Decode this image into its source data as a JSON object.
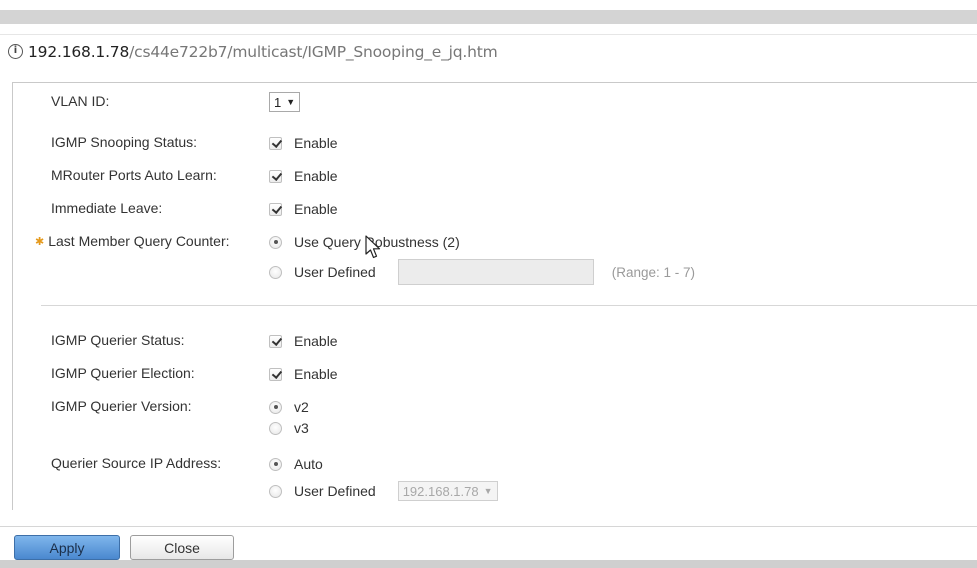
{
  "browser": {
    "url_host": "192.168.1.78",
    "url_path": "/cs44e722b7/multicast/IGMP_Snooping_e_jq.htm"
  },
  "form": {
    "vlan_id": {
      "label": "VLAN ID:",
      "value": "1"
    },
    "igmp_snooping_status": {
      "label": "IGMP Snooping Status:",
      "option": "Enable",
      "checked": true
    },
    "mrouter_auto_learn": {
      "label": "MRouter Ports Auto Learn:",
      "option": "Enable",
      "checked": true
    },
    "immediate_leave": {
      "label": "Immediate Leave:",
      "option": "Enable",
      "checked": true
    },
    "last_member_query_counter": {
      "label": "Last Member Query Counter:",
      "option_robustness": "Use Query Robustness (2)",
      "option_user_defined": "User Defined",
      "range_hint": "(Range: 1 - 7)",
      "selected": "robustness",
      "value": ""
    },
    "igmp_querier_status": {
      "label": "IGMP Querier Status:",
      "option": "Enable",
      "checked": true
    },
    "igmp_querier_election": {
      "label": "IGMP Querier Election:",
      "option": "Enable",
      "checked": true
    },
    "igmp_querier_version": {
      "label": "IGMP Querier Version:",
      "option_v2": "v2",
      "option_v3": "v3",
      "selected": "v2"
    },
    "querier_source_ip": {
      "label": "Querier Source IP Address:",
      "option_auto": "Auto",
      "option_user_defined": "User Defined",
      "selected": "auto",
      "ip_value": "192.168.1.78"
    }
  },
  "footer": {
    "apply_label": "Apply",
    "close_label": "Close"
  },
  "colors": {
    "primary_button": "#5a96d8",
    "required_icon": "#e59a1d"
  },
  "icons": {
    "info": "info-circle-icon",
    "required": "gear-icon",
    "dropdown": "chevron-down-icon"
  }
}
